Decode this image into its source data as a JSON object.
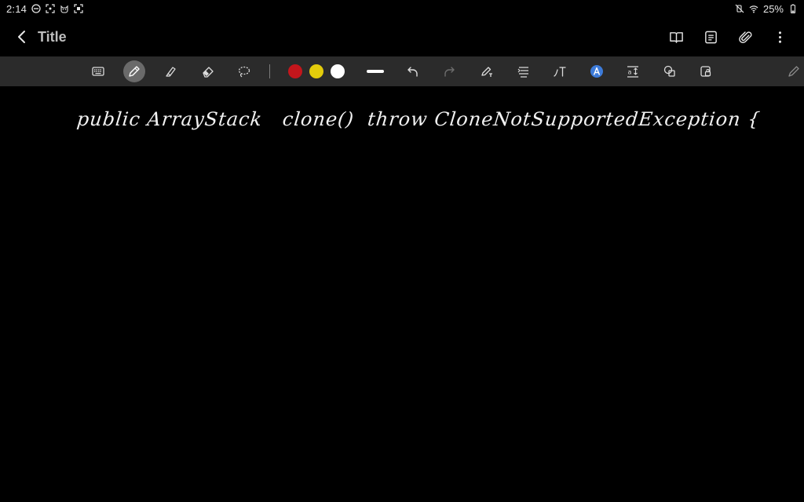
{
  "status": {
    "time": "2:14",
    "battery": "25%",
    "left_icons": [
      "do-not-disturb-icon",
      "screenshot-icon",
      "cat-face-icon",
      "screen-record-icon"
    ],
    "right_icons": [
      "mute-vibrate-icon",
      "wifi-icon",
      "battery-icon"
    ]
  },
  "header": {
    "title": "Title",
    "actions": [
      "book-view-icon",
      "page-list-icon",
      "attach-icon",
      "more-vertical-icon"
    ]
  },
  "toolbar": {
    "colors": [
      "#c4161c",
      "#e3cc0b",
      "#ffffff"
    ],
    "active_tool": "pen"
  },
  "canvas": {
    "handwriting": "public ArrayStack   clone()  throw CloneNotSupportedException {"
  },
  "theme": {
    "background": "#000000",
    "toolbar_bg": "#2b2b2b",
    "accent_blue": "#3d7bd9"
  }
}
